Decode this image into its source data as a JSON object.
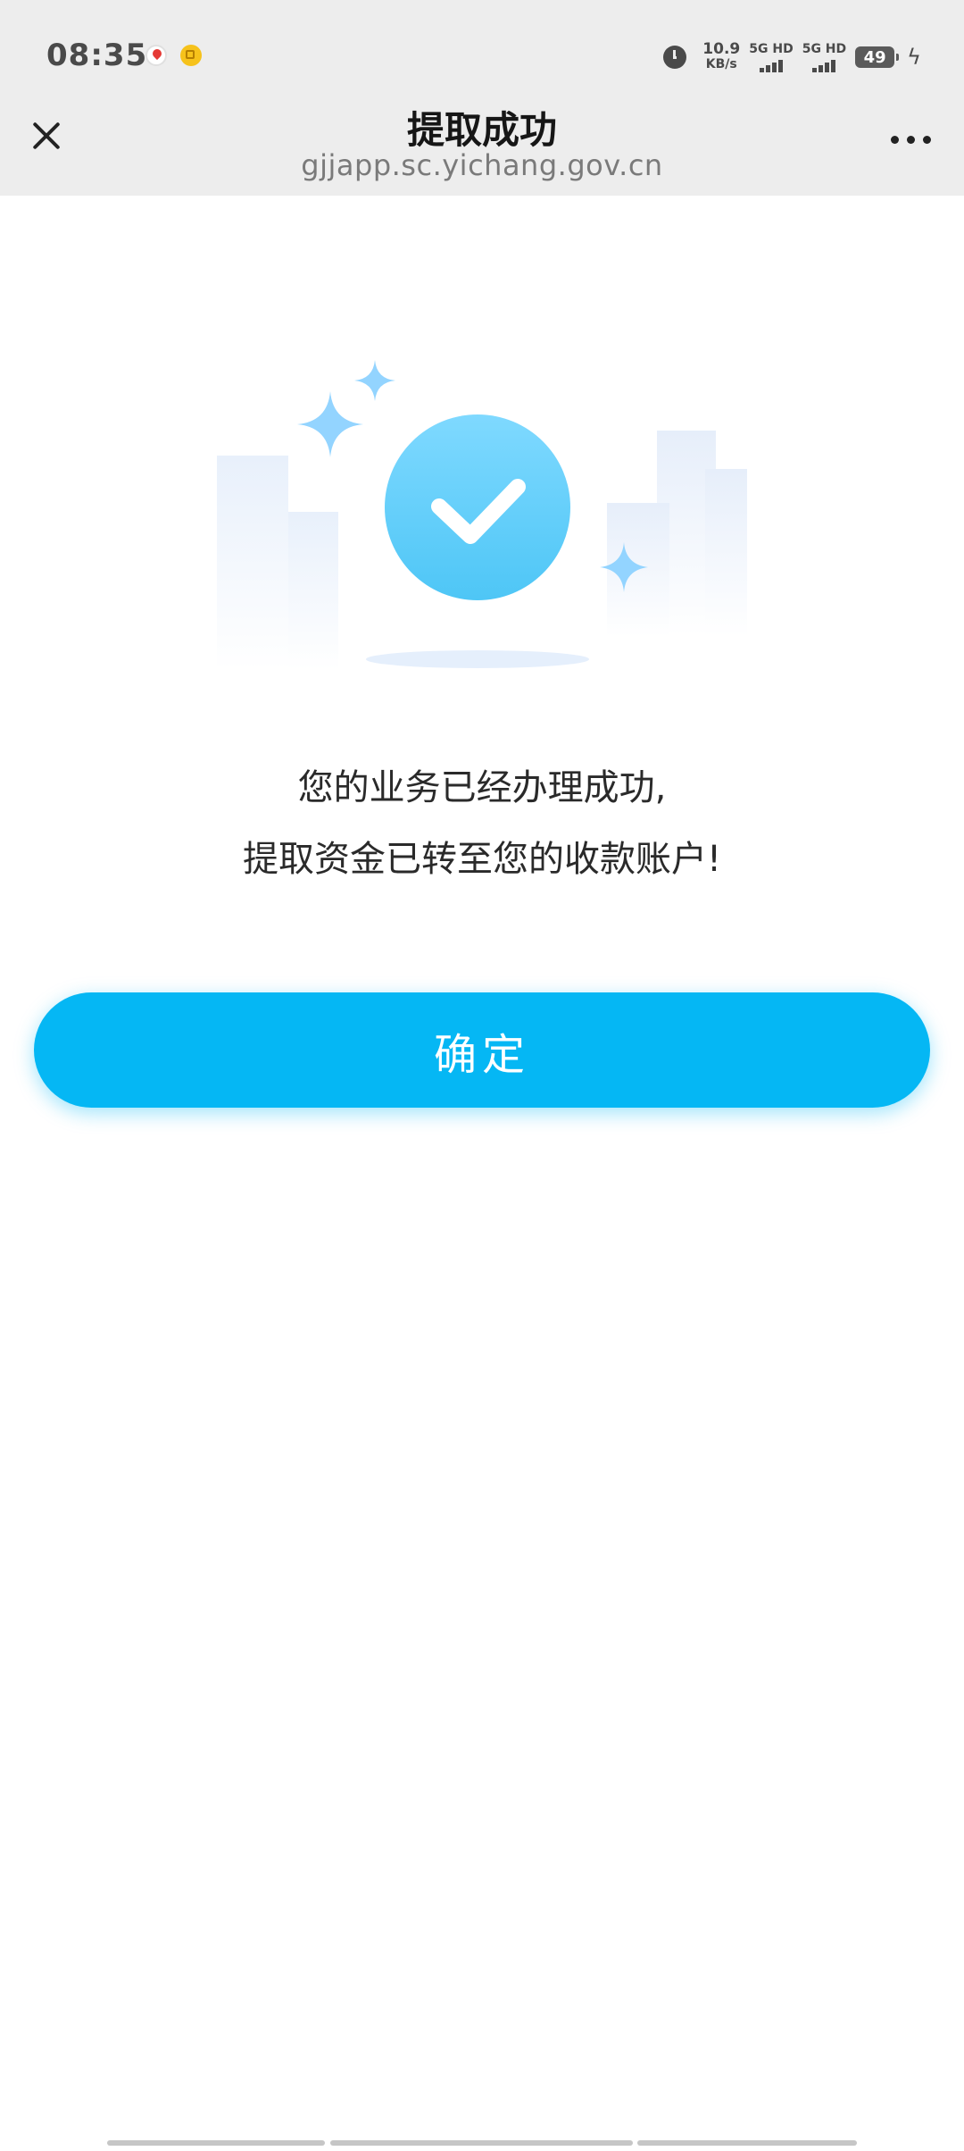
{
  "status_bar": {
    "time": "08:35",
    "net_speed_value": "10.9",
    "net_speed_unit": "KB/s",
    "sim1_label": "5G HD",
    "sim2_label": "5G HD",
    "battery": "49"
  },
  "title_bar": {
    "title": "提取成功",
    "url": "gjjapp.sc.yichang.gov.cn"
  },
  "message": {
    "line1": "您的业务已经办理成功,",
    "line2": "提取资金已转至您的收款账户!"
  },
  "confirm_button": {
    "label": "确定"
  },
  "colors": {
    "accent": "#05b7f4",
    "header_bg": "#ededed"
  },
  "icons": {
    "close": "close-icon",
    "more": "more-icon",
    "success": "check-circle-icon",
    "sparkle": "sparkle-icon"
  }
}
